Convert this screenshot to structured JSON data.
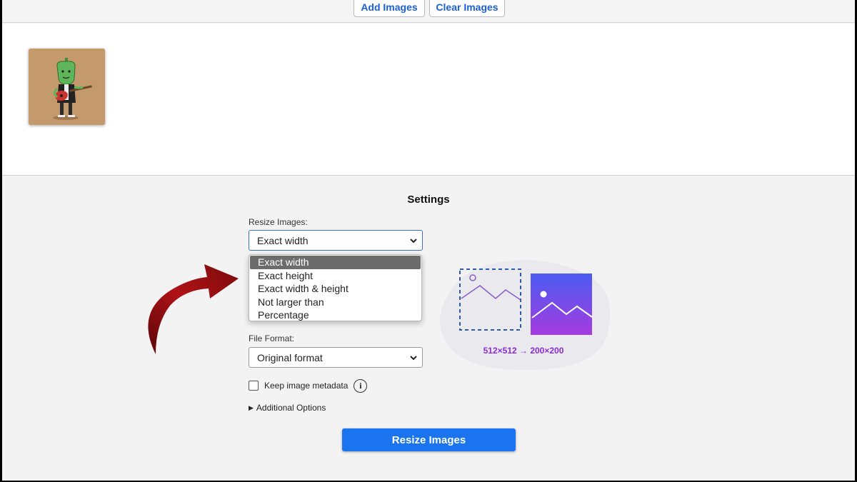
{
  "toolbar": {
    "add_images": "Add Images",
    "clear_images": "Clear Images"
  },
  "images": [
    {
      "name": "guitar-character-thumbnail"
    }
  ],
  "settings": {
    "title": "Settings",
    "resize_label": "Resize Images:",
    "resize_selected": "Exact width",
    "resize_options": [
      "Exact width",
      "Exact height",
      "Exact width & height",
      "Not larger than",
      "Percentage"
    ],
    "file_format_label": "File Format:",
    "file_format_selected": "Original format",
    "keep_metadata_label": "Keep image metadata",
    "keep_metadata_checked": false,
    "info_glyph": "i",
    "additional_options": "Additional Options",
    "resize_button": "Resize Images",
    "dims_caption": "512×512 → 200×200"
  },
  "colors": {
    "accent": "#1a74f0",
    "link_text": "#1a5fd6",
    "selected_option": "#6c6c6c",
    "annotation_arrow": "#9c0f12",
    "dims_caption": "#8a2bd6"
  },
  "icons": {
    "dropdown": "chevron-down-icon",
    "info": "info-icon",
    "expander": "triangle-right-icon"
  }
}
